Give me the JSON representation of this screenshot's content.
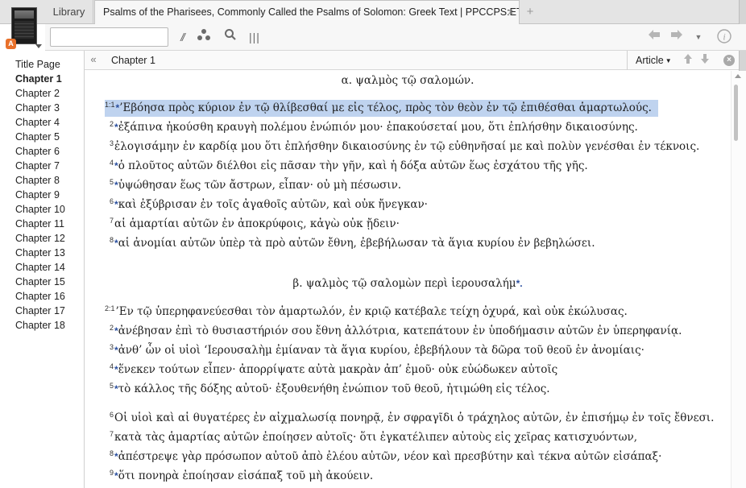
{
  "tabs": {
    "library_label": "Library",
    "active_title": "Psalms of the Pharisees, Commonly Called the Psalms of Solomon: Greek Text | PPCCPS:ET",
    "close_glyph": "×",
    "add_glyph": "+",
    "cover_badge": "A"
  },
  "toolbar": {
    "search_value": "",
    "search_placeholder": "",
    "parallel_glyph": "//",
    "columns_glyph": "|||",
    "info_glyph": "i",
    "icons": [
      "parallel-resources-icon",
      "visual-filter-icon",
      "search-icon",
      "columns-icon",
      "back-arrow-icon",
      "forward-arrow-icon",
      "history-dropdown-icon",
      "info-icon"
    ]
  },
  "sidebar": {
    "items": [
      {
        "label": "Title Page",
        "active": false
      },
      {
        "label": "Chapter 1",
        "active": true
      },
      {
        "label": "Chapter 2",
        "active": false
      },
      {
        "label": "Chapter 3",
        "active": false
      },
      {
        "label": "Chapter 4",
        "active": false
      },
      {
        "label": "Chapter 5",
        "active": false
      },
      {
        "label": "Chapter 6",
        "active": false
      },
      {
        "label": "Chapter 7",
        "active": false
      },
      {
        "label": "Chapter 8",
        "active": false
      },
      {
        "label": "Chapter 9",
        "active": false
      },
      {
        "label": "Chapter 10",
        "active": false
      },
      {
        "label": "Chapter 11",
        "active": false
      },
      {
        "label": "Chapter 12",
        "active": false
      },
      {
        "label": "Chapter 13",
        "active": false
      },
      {
        "label": "Chapter 14",
        "active": false
      },
      {
        "label": "Chapter 15",
        "active": false
      },
      {
        "label": "Chapter 16",
        "active": false
      },
      {
        "label": "Chapter 17",
        "active": false
      },
      {
        "label": "Chapter 18",
        "active": false
      }
    ]
  },
  "header": {
    "collapse_glyph": "«",
    "chapter": "Chapter 1",
    "view_mode": "Article",
    "caret": "▼"
  },
  "content": {
    "psalm1": {
      "heading": "α. ψαλμὸς τῷ σαλομών.",
      "verses": [
        {
          "num": "1:1",
          "star": true,
          "text": "’Εβόησα πρὸς κύριον ἐν τῷ θλίβεσθαί με εἰς τέλος, πρὸς τὸν θεὸν ἐν τῷ ἐπιθέσθαι ἁμαρτωλούς."
        },
        {
          "num": "2",
          "star": true,
          "text": "ἐξάπινα ἠκούσθη κραυγὴ πολέμου ἐνώπιόν μου· ἐπακούσεταί μου, ὅτι ἐπλήσθην δικαιοσύνης."
        },
        {
          "num": "3",
          "star": false,
          "text": "ἐλογισάμην ἐν καρδίᾳ μου ὅτι ἐπλήσθην δικαιοσύνης ἐν τῷ εὐθηνῆσαί με καὶ πολὺν γενέσθαι ἐν τέκνοις."
        },
        {
          "num": "4",
          "star": true,
          "text": "ὁ πλοῦτος αὐτῶν διέλθοι εἰς πᾶσαν τὴν γῆν, καὶ ἡ δόξα αὐτῶν ἕως ἐσχάτου τῆς γῆς."
        },
        {
          "num": "5",
          "star": true,
          "text": "ὑψώθησαν ἕως τῶν ἄστρων, εἶπαν· οὐ μὴ πέσωσιν."
        },
        {
          "num": "6",
          "star": true,
          "text": "καὶ ἐξύβρισαν ἐν τοῖς ἀγαθοῖς αὐτῶν, καὶ οὐκ ἤνεγκαν·"
        },
        {
          "num": "7",
          "star": false,
          "text": "αἱ ἁμαρτίαι αὐτῶν ἐν ἀποκρύφοις, κἀγὼ οὐκ ᾔδειν·"
        },
        {
          "num": "8",
          "star": true,
          "text": "αἱ ἀνομίαι αὐτῶν ὑπὲρ τὰ πρὸ αὐτῶν ἔθνη, ἐβεβήλωσαν τὰ ἅγια κυρίου ἐν βεβηλώσει."
        }
      ]
    },
    "psalm2": {
      "heading": "β. ψαλμὸς τῷ σαλομὼν περὶ ἱερουσαλήμ",
      "heading_star": "*.",
      "verses": [
        {
          "num": "2:1",
          "star": false,
          "text": "’Εν τῷ ὑπερηφανεύεσθαι τὸν ἁμαρτωλόν, ἐν κριῷ κατέβαλε τείχη ὀχυρά, καὶ οὐκ ἐκώλυσας."
        },
        {
          "num": "2",
          "star": true,
          "text": "ἀνέβησαν ἐπὶ τὸ θυσιαστήριόν σου ἔθνη ἀλλότρια, κατεπάτουν ἐν ὑποδήμασιν αὐτῶν ἐν ὑπερηφανίᾳ."
        },
        {
          "num": "3",
          "star": true,
          "text": "ἀνθ’ ὧν οἱ υἱοὶ ‘Ιερουσαλὴμ ἐμίαναν τὰ ἅγια κυρίου, ἐβεβήλουν τὰ δῶρα τοῦ θεοῦ ἐν ἀνομίαις·"
        },
        {
          "num": "4",
          "star": true,
          "text": "ἕνεκεν τούτων εἶπεν· ἀπορρίψατε αὐτὰ μακρὰν ἀπ’ ἐμοῦ· οὐκ εὐώδωκεν αὐτοῖς"
        },
        {
          "num": "5",
          "star": true,
          "text": "τὸ κάλλος τῆς δόξης αὐτοῦ· ἐξουθενήθη ἐνώπιον τοῦ θεοῦ, ἠτιμώθη εἰς τέλος."
        },
        {
          "num": "6",
          "star": false,
          "text": "Οἱ υἱοὶ καὶ αἱ θυγατέρες ἐν αἰχμαλωσίᾳ πονηρᾷ, ἐν σφραγῖδι ὁ τράχηλος αὐτῶν, ἐν ἐπισήμῳ ἐν τοῖς ἔθνεσι."
        },
        {
          "num": "7",
          "star": false,
          "text": "κατὰ τὰς ἁμαρτίας αὐτῶν ἐποίησεν αὐτοῖς· ὅτι ἐγκατέλιπεν αὐτοὺς εἰς χεῖρας κατισχυόντων,"
        },
        {
          "num": "8",
          "star": true,
          "text": "ἀπέστρεψε γὰρ πρόσωπον αὐτοῦ ἀπὸ ἐλέου αὐτῶν, νέον καὶ πρεσβύτην καὶ τέκνα αὐτῶν εἰσάπαξ·"
        },
        {
          "num": "9",
          "star": true,
          "text": "ὅτι πονηρὰ ἐποίησαν εἰσάπαξ τοῦ μὴ ἀκούειν."
        }
      ]
    }
  },
  "colors": {
    "highlight": "#bfd3ef",
    "star_marker": "#2b4f9e",
    "badge": "#e8702a"
  }
}
